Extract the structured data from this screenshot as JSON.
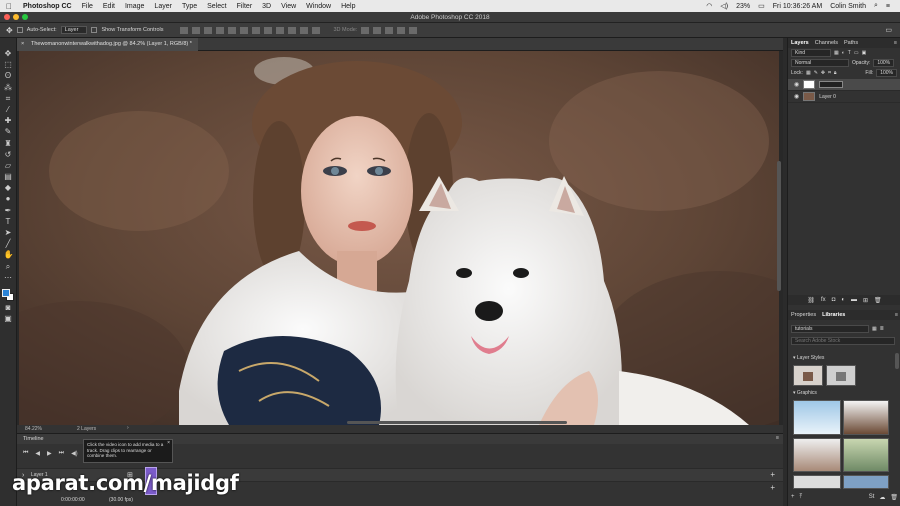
{
  "menubar": {
    "apple": "",
    "app": "Photoshop CC",
    "items": [
      "File",
      "Edit",
      "Image",
      "Layer",
      "Type",
      "Select",
      "Filter",
      "3D",
      "View",
      "Window",
      "Help"
    ],
    "battery": "23%",
    "clock": "Fri 10:36:26 AM",
    "user": "Colin Smith"
  },
  "titlebar": {
    "title": "Adobe Photoshop CC 2018"
  },
  "options": {
    "auto_select": "Auto-Select:",
    "auto_select_value": "Layer",
    "show_transform": "Show Transform Controls",
    "mode_3d": "3D Mode:"
  },
  "document": {
    "tab": "Thewomanonwinterwalkwithadog.jpg @ 84.2% (Layer 1, RGB/8) *"
  },
  "status": {
    "zoom": "84.22%",
    "layers": "2 Layers"
  },
  "timeline": {
    "title": "Timeline",
    "track_name": "Layer 1",
    "time": "0:00:00:00",
    "fps": "(30.00 fps)"
  },
  "tooltip": {
    "text": "Click the video icon to add media to a track. Drag clips to rearrange or combine them."
  },
  "watermark": "aparat.com/majidgf",
  "layers_panel": {
    "tabs": [
      "Layers",
      "Channels",
      "Paths"
    ],
    "filter": "Kind",
    "blend": "Normal",
    "opacity_label": "Opacity:",
    "opacity": "100%",
    "lock_label": "Lock:",
    "fill_label": "Fill:",
    "fill": "100%",
    "layers": [
      {
        "name": ""
      },
      {
        "name": "Layer 0"
      }
    ]
  },
  "libraries_panel": {
    "tabs": [
      "Properties",
      "Libraries"
    ],
    "library": "tutorials",
    "search_placeholder": "Search Adobe Stock",
    "layer_styles": "Layer Styles",
    "graphics": "Graphics"
  },
  "colors": {
    "foreground": "#2a83d6",
    "background": "#ffffff",
    "clip": "#7b5bc9"
  }
}
